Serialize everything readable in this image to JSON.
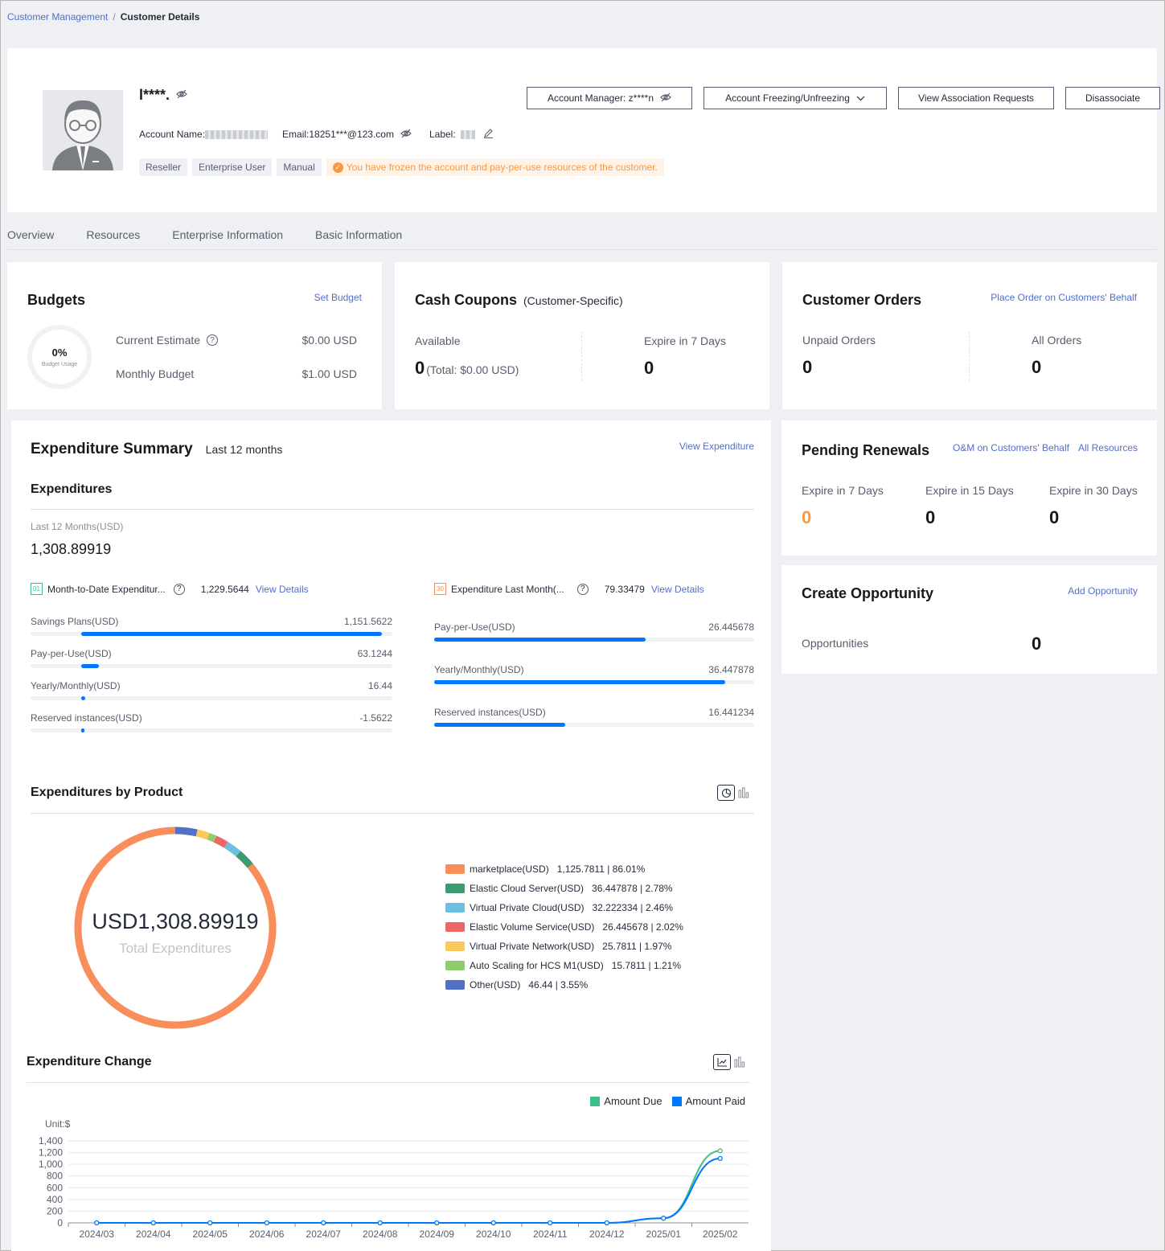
{
  "breadcrumb": {
    "parent": "Customer Management",
    "separator": "/",
    "current": "Customer Details"
  },
  "profile": {
    "name": "l****.",
    "account_name_label": "Account Name:",
    "email": "Email:18251***@123.com",
    "label_label": "Label:",
    "tags": [
      "Reseller",
      "Enterprise User",
      "Manual"
    ],
    "warning": "You have frozen the account and pay-per-use resources of the customer."
  },
  "actions": {
    "account_manager": "Account Manager: z****n",
    "freeze": "Account Freezing/Unfreezing",
    "association": "View Association Requests",
    "disassociate": "Disassociate"
  },
  "tabs": [
    "Overview",
    "Resources",
    "Enterprise Information",
    "Basic Information"
  ],
  "budgets": {
    "title": "Budgets",
    "link": "Set Budget",
    "usage_pct": "0%",
    "usage_label": "Budget Usage",
    "current_estimate_label": "Current Estimate",
    "current_estimate_value": "$0.00 USD",
    "monthly_budget_label": "Monthly Budget",
    "monthly_budget_value": "$1.00 USD"
  },
  "coupons": {
    "title": "Cash Coupons",
    "subtitle": "(Customer-Specific)",
    "available_label": "Available",
    "available_value": "0",
    "available_total": "(Total: $0.00 USD)",
    "expire_label": "Expire in 7 Days",
    "expire_value": "0"
  },
  "orders": {
    "title": "Customer Orders",
    "link": "Place Order on Customers' Behalf",
    "unpaid_label": "Unpaid Orders",
    "unpaid_value": "0",
    "all_label": "All Orders",
    "all_value": "0"
  },
  "expenditure": {
    "title": "Expenditure Summary",
    "period": "Last 12 months",
    "link": "View Expenditure",
    "section": "Expenditures",
    "last12_label": "Last 12 Months(USD)",
    "last12_value": "1,308.89919",
    "mtd": {
      "label": "Month-to-Date Expenditur...",
      "value": "1,229.5644",
      "link": "View Details",
      "icon_day": "01",
      "rows": [
        {
          "label": "Savings Plans(USD)",
          "value": "1,151.5622",
          "fill_start": 0.14,
          "fill_end": 0.97
        },
        {
          "label": "Pay-per-Use(USD)",
          "value": "63.1244",
          "fill_start": 0.14,
          "fill_end": 0.188
        },
        {
          "label": "Yearly/Monthly(USD)",
          "value": "16.44",
          "fill_start": 0.14,
          "fill_end": 0.152
        },
        {
          "label": "Reserved instances(USD)",
          "value": "-1.5622",
          "fill_start": 0.14,
          "fill_end": 0.141
        }
      ]
    },
    "last_month": {
      "label": "Expenditure Last Month(...",
      "value": "79.33479",
      "link": "View Details",
      "icon_day": "30",
      "rows": [
        {
          "label": "Pay-per-Use(USD)",
          "value": "26.445678",
          "fill_start": 0,
          "fill_end": 0.66
        },
        {
          "label": "Yearly/Monthly(USD)",
          "value": "36.447878",
          "fill_start": 0,
          "fill_end": 0.91
        },
        {
          "label": "Reserved instances(USD)",
          "value": "16.441234",
          "fill_start": 0,
          "fill_end": 0.41
        }
      ]
    }
  },
  "by_product": {
    "title": "Expenditures by Product",
    "total": "USD1,308.89919",
    "total_label": "Total Expenditures",
    "colors": {
      "marketplace": "#f98d5c",
      "ecs": "#3c9c6f",
      "vpc": "#6cbfe0",
      "evs": "#ee6666",
      "vpn": "#fbc85a",
      "as": "#8ecc6f",
      "other": "#5470c6"
    }
  },
  "chart_data": [
    {
      "type": "pie",
      "categories": [
        "marketplace(USD)",
        "Elastic Cloud Server(USD)",
        "Virtual Private Cloud(USD)",
        "Elastic Volume Service(USD)",
        "Virtual Private Network(USD)",
        "Auto Scaling for HCS M1(USD)",
        "Other(USD)"
      ],
      "values": [
        1125.7811,
        36.447878,
        32.222334,
        26.445678,
        25.7811,
        15.7811,
        46.44
      ],
      "percents": [
        "86.01%",
        "2.78%",
        "2.46%",
        "2.02%",
        "1.97%",
        "1.21%",
        "3.55%"
      ],
      "value_labels": [
        "1,125.7811",
        "36.447878",
        "32.222334",
        "26.445678",
        "25.7811",
        "15.7811",
        "46.44"
      ],
      "colors": [
        "#f98d5c",
        "#3c9c6f",
        "#6cbfe0",
        "#ee6666",
        "#fbc85a",
        "#8ecc6f",
        "#5470c6"
      ]
    },
    {
      "type": "line",
      "title": "Expenditure Change",
      "unit": "Unit:$",
      "x": [
        "2024/03",
        "2024/04",
        "2024/05",
        "2024/06",
        "2024/07",
        "2024/08",
        "2024/09",
        "2024/10",
        "2024/11",
        "2024/12",
        "2025/01",
        "2025/02"
      ],
      "series": [
        {
          "name": "Amount Due",
          "color": "#3cc08a",
          "values": [
            0,
            0,
            0,
            0,
            0,
            0,
            0,
            0,
            0,
            0,
            80,
            1229.5644
          ]
        },
        {
          "name": "Amount Paid",
          "color": "#0077ff",
          "values": [
            0,
            0,
            0,
            0,
            0,
            0,
            0,
            0,
            0,
            0,
            79.33479,
            1100
          ]
        }
      ],
      "yticks": [
        "1,400",
        "1,200",
        "1,000",
        "800",
        "600",
        "400",
        "200",
        "0"
      ],
      "ylim": [
        0,
        1400
      ],
      "grid": true,
      "legend": "top-right"
    }
  ],
  "renewals": {
    "title": "Pending Renewals",
    "link1": "O&M on Customers' Behalf",
    "link2": "All Resources",
    "items": [
      {
        "label": "Expire in 7 Days",
        "value": "0",
        "color": "#fa9841"
      },
      {
        "label": "Expire in 15 Days",
        "value": "0",
        "color": "#191919"
      },
      {
        "label": "Expire in 30 Days",
        "value": "0",
        "color": "#191919"
      }
    ]
  },
  "opportunity": {
    "title": "Create Opportunity",
    "link": "Add Opportunity",
    "label": "Opportunities",
    "value": "0"
  }
}
